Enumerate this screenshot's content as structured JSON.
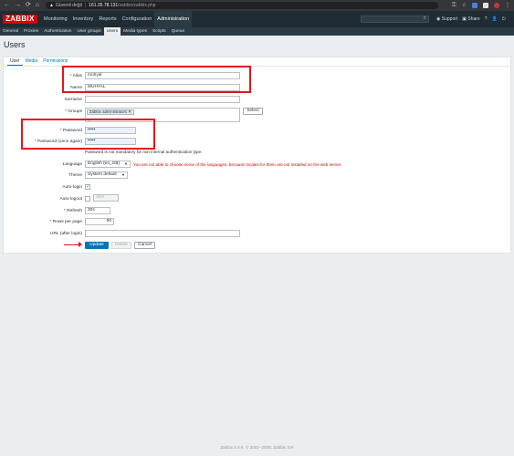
{
  "browser": {
    "security_label": "Güvenli değil",
    "host": "161.35.78.131",
    "path": "/zabbix/zabbix.php"
  },
  "app": {
    "logo": "ZABBIX",
    "main_menu": [
      "Monitoring",
      "Inventory",
      "Reports",
      "Configuration",
      "Administration"
    ],
    "support_label": "Support",
    "share_label": "Share",
    "help_label": "?"
  },
  "submenu": [
    "General",
    "Proxies",
    "Authentication",
    "User groups",
    "Users",
    "Media types",
    "Scripts",
    "Queue"
  ],
  "page_title": "Users",
  "tabs": [
    "User",
    "Media",
    "Permissions"
  ],
  "form": {
    "alias_label": "Alias",
    "alias_value": "muhyal",
    "name_label": "Name",
    "name_value": "MUHYAL",
    "surname_label": "Surname",
    "surname_value": "",
    "groups_label": "Groups",
    "group_chip": "Zabbix administrators",
    "groups_hint": "type here to search",
    "select_button": "Select",
    "password_label": "Password",
    "password_value": "•••••",
    "password_again_label": "Password (once again)",
    "password_again_value": "•••••",
    "password_note": "Password is not mandatory for non internal authentication type.",
    "language_label": "Language",
    "language_value": "English (en_GB)",
    "language_error": "You are not able to choose some of the languages, because locales for them are not installed on the web server.",
    "theme_label": "Theme",
    "theme_value": "System default",
    "autologin_label": "Auto-login",
    "autologout_label": "Auto-logout",
    "autologout_value": "15m",
    "refresh_label": "Refresh",
    "refresh_value": "30s",
    "rows_label": "Rows per page",
    "rows_value": "50",
    "url_label": "URL (after login)",
    "url_value": "",
    "update_button": "Update",
    "delete_button": "Delete",
    "cancel_button": "Cancel"
  },
  "footer": "Zabbix 4.4.6. © 2001–2020, Zabbix SIA",
  "colors": {
    "brand": "#d40000",
    "accent": "#0275b8",
    "highlight": "#e8131b"
  }
}
